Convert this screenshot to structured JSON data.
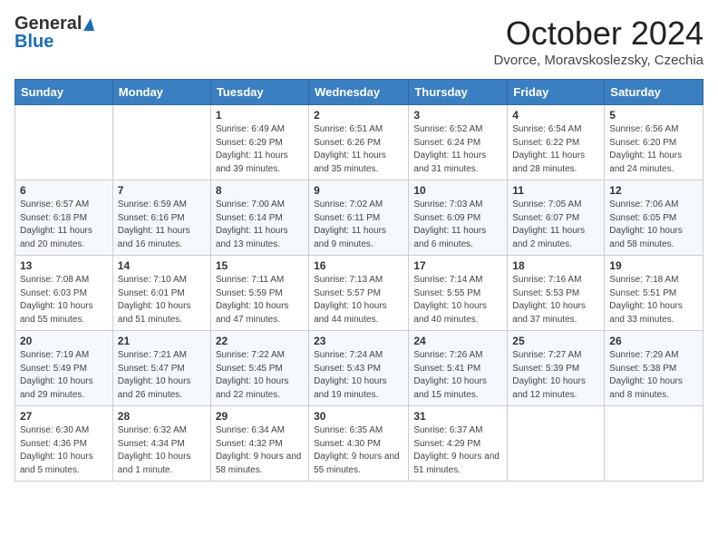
{
  "header": {
    "logo_line1": "General",
    "logo_line2": "Blue",
    "month": "October 2024",
    "location": "Dvorce, Moravskoslezsky, Czechia"
  },
  "days_of_week": [
    "Sunday",
    "Monday",
    "Tuesday",
    "Wednesday",
    "Thursday",
    "Friday",
    "Saturday"
  ],
  "weeks": [
    [
      {
        "day": "",
        "sunrise": "",
        "sunset": "",
        "daylight": ""
      },
      {
        "day": "",
        "sunrise": "",
        "sunset": "",
        "daylight": ""
      },
      {
        "day": "1",
        "sunrise": "Sunrise: 6:49 AM",
        "sunset": "Sunset: 6:29 PM",
        "daylight": "Daylight: 11 hours and 39 minutes."
      },
      {
        "day": "2",
        "sunrise": "Sunrise: 6:51 AM",
        "sunset": "Sunset: 6:26 PM",
        "daylight": "Daylight: 11 hours and 35 minutes."
      },
      {
        "day": "3",
        "sunrise": "Sunrise: 6:52 AM",
        "sunset": "Sunset: 6:24 PM",
        "daylight": "Daylight: 11 hours and 31 minutes."
      },
      {
        "day": "4",
        "sunrise": "Sunrise: 6:54 AM",
        "sunset": "Sunset: 6:22 PM",
        "daylight": "Daylight: 11 hours and 28 minutes."
      },
      {
        "day": "5",
        "sunrise": "Sunrise: 6:56 AM",
        "sunset": "Sunset: 6:20 PM",
        "daylight": "Daylight: 11 hours and 24 minutes."
      }
    ],
    [
      {
        "day": "6",
        "sunrise": "Sunrise: 6:57 AM",
        "sunset": "Sunset: 6:18 PM",
        "daylight": "Daylight: 11 hours and 20 minutes."
      },
      {
        "day": "7",
        "sunrise": "Sunrise: 6:59 AM",
        "sunset": "Sunset: 6:16 PM",
        "daylight": "Daylight: 11 hours and 16 minutes."
      },
      {
        "day": "8",
        "sunrise": "Sunrise: 7:00 AM",
        "sunset": "Sunset: 6:14 PM",
        "daylight": "Daylight: 11 hours and 13 minutes."
      },
      {
        "day": "9",
        "sunrise": "Sunrise: 7:02 AM",
        "sunset": "Sunset: 6:11 PM",
        "daylight": "Daylight: 11 hours and 9 minutes."
      },
      {
        "day": "10",
        "sunrise": "Sunrise: 7:03 AM",
        "sunset": "Sunset: 6:09 PM",
        "daylight": "Daylight: 11 hours and 6 minutes."
      },
      {
        "day": "11",
        "sunrise": "Sunrise: 7:05 AM",
        "sunset": "Sunset: 6:07 PM",
        "daylight": "Daylight: 11 hours and 2 minutes."
      },
      {
        "day": "12",
        "sunrise": "Sunrise: 7:06 AM",
        "sunset": "Sunset: 6:05 PM",
        "daylight": "Daylight: 10 hours and 58 minutes."
      }
    ],
    [
      {
        "day": "13",
        "sunrise": "Sunrise: 7:08 AM",
        "sunset": "Sunset: 6:03 PM",
        "daylight": "Daylight: 10 hours and 55 minutes."
      },
      {
        "day": "14",
        "sunrise": "Sunrise: 7:10 AM",
        "sunset": "Sunset: 6:01 PM",
        "daylight": "Daylight: 10 hours and 51 minutes."
      },
      {
        "day": "15",
        "sunrise": "Sunrise: 7:11 AM",
        "sunset": "Sunset: 5:59 PM",
        "daylight": "Daylight: 10 hours and 47 minutes."
      },
      {
        "day": "16",
        "sunrise": "Sunrise: 7:13 AM",
        "sunset": "Sunset: 5:57 PM",
        "daylight": "Daylight: 10 hours and 44 minutes."
      },
      {
        "day": "17",
        "sunrise": "Sunrise: 7:14 AM",
        "sunset": "Sunset: 5:55 PM",
        "daylight": "Daylight: 10 hours and 40 minutes."
      },
      {
        "day": "18",
        "sunrise": "Sunrise: 7:16 AM",
        "sunset": "Sunset: 5:53 PM",
        "daylight": "Daylight: 10 hours and 37 minutes."
      },
      {
        "day": "19",
        "sunrise": "Sunrise: 7:18 AM",
        "sunset": "Sunset: 5:51 PM",
        "daylight": "Daylight: 10 hours and 33 minutes."
      }
    ],
    [
      {
        "day": "20",
        "sunrise": "Sunrise: 7:19 AM",
        "sunset": "Sunset: 5:49 PM",
        "daylight": "Daylight: 10 hours and 29 minutes."
      },
      {
        "day": "21",
        "sunrise": "Sunrise: 7:21 AM",
        "sunset": "Sunset: 5:47 PM",
        "daylight": "Daylight: 10 hours and 26 minutes."
      },
      {
        "day": "22",
        "sunrise": "Sunrise: 7:22 AM",
        "sunset": "Sunset: 5:45 PM",
        "daylight": "Daylight: 10 hours and 22 minutes."
      },
      {
        "day": "23",
        "sunrise": "Sunrise: 7:24 AM",
        "sunset": "Sunset: 5:43 PM",
        "daylight": "Daylight: 10 hours and 19 minutes."
      },
      {
        "day": "24",
        "sunrise": "Sunrise: 7:26 AM",
        "sunset": "Sunset: 5:41 PM",
        "daylight": "Daylight: 10 hours and 15 minutes."
      },
      {
        "day": "25",
        "sunrise": "Sunrise: 7:27 AM",
        "sunset": "Sunset: 5:39 PM",
        "daylight": "Daylight: 10 hours and 12 minutes."
      },
      {
        "day": "26",
        "sunrise": "Sunrise: 7:29 AM",
        "sunset": "Sunset: 5:38 PM",
        "daylight": "Daylight: 10 hours and 8 minutes."
      }
    ],
    [
      {
        "day": "27",
        "sunrise": "Sunrise: 6:30 AM",
        "sunset": "Sunset: 4:36 PM",
        "daylight": "Daylight: 10 hours and 5 minutes."
      },
      {
        "day": "28",
        "sunrise": "Sunrise: 6:32 AM",
        "sunset": "Sunset: 4:34 PM",
        "daylight": "Daylight: 10 hours and 1 minute."
      },
      {
        "day": "29",
        "sunrise": "Sunrise: 6:34 AM",
        "sunset": "Sunset: 4:32 PM",
        "daylight": "Daylight: 9 hours and 58 minutes."
      },
      {
        "day": "30",
        "sunrise": "Sunrise: 6:35 AM",
        "sunset": "Sunset: 4:30 PM",
        "daylight": "Daylight: 9 hours and 55 minutes."
      },
      {
        "day": "31",
        "sunrise": "Sunrise: 6:37 AM",
        "sunset": "Sunset: 4:29 PM",
        "daylight": "Daylight: 9 hours and 51 minutes."
      },
      {
        "day": "",
        "sunrise": "",
        "sunset": "",
        "daylight": ""
      },
      {
        "day": "",
        "sunrise": "",
        "sunset": "",
        "daylight": ""
      }
    ]
  ]
}
